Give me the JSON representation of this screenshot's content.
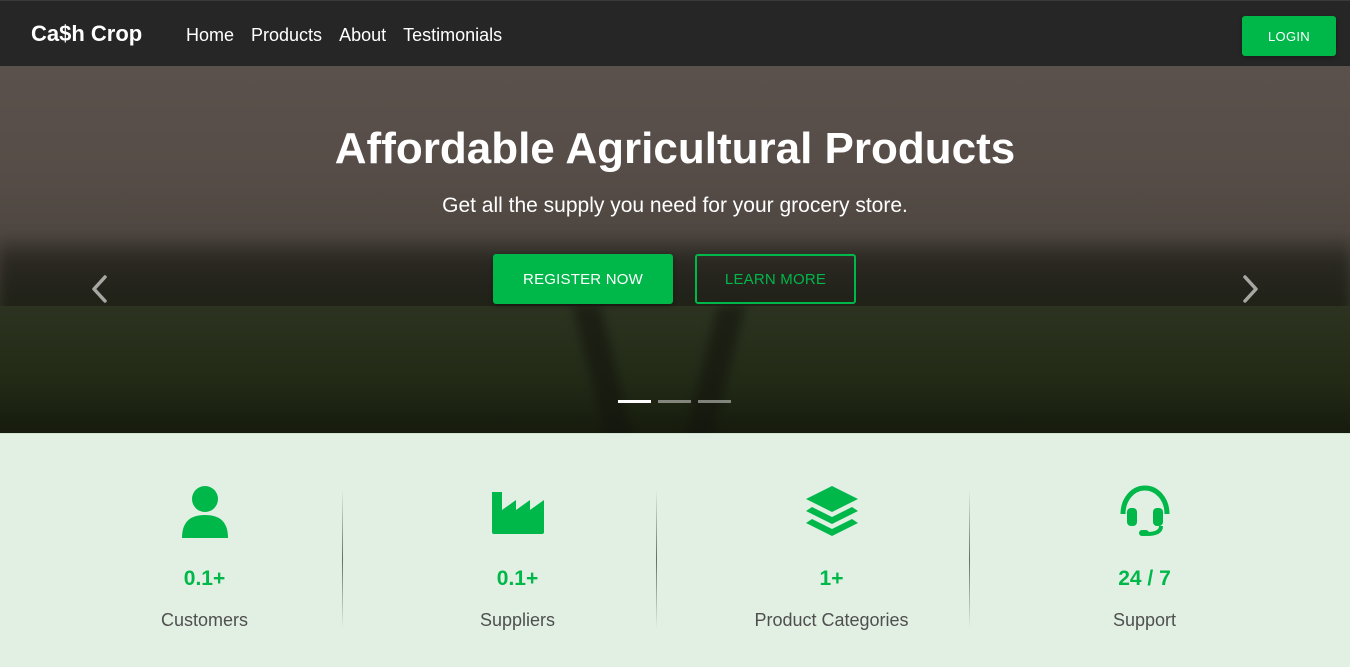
{
  "navbar": {
    "brand": "Ca$h Crop",
    "links": [
      "Home",
      "Products",
      "About",
      "Testimonials"
    ],
    "login_label": "LOGIN"
  },
  "hero": {
    "title": "Affordable Agricultural Products",
    "subtitle": "Get all the supply you need for your grocery store.",
    "register_label": "REGISTER NOW",
    "learn_label": "LEARN MORE",
    "slides_total": 3,
    "active_slide": 1
  },
  "stats": [
    {
      "icon": "user-icon",
      "value": "0.1+",
      "label": "Customers"
    },
    {
      "icon": "factory-icon",
      "value": "0.1+",
      "label": "Suppliers"
    },
    {
      "icon": "layers-icon",
      "value": "1+",
      "label": "Product Categories"
    },
    {
      "icon": "headset-icon",
      "value": "24 / 7",
      "label": "Support"
    }
  ],
  "colors": {
    "accent": "#00b74a",
    "navbar_bg": "#262626",
    "stats_bg": "#e2f0e3",
    "label_text": "#4f4f4f"
  }
}
